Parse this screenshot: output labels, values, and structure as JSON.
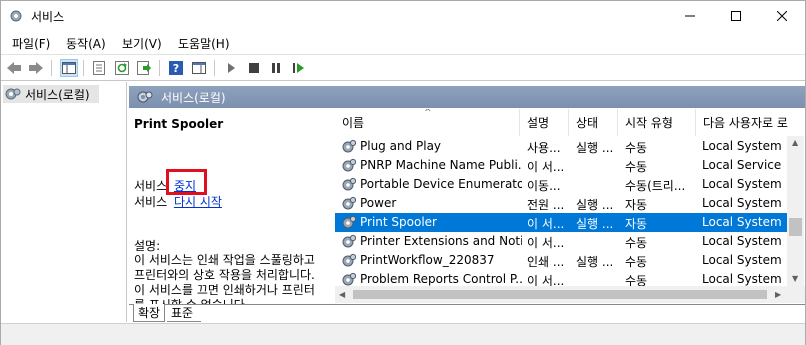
{
  "window": {
    "title": "서비스"
  },
  "menu": [
    "파일(F)",
    "동작(A)",
    "보기(V)",
    "도움말(H)"
  ],
  "tree": {
    "root_label": "서비스(로컬)"
  },
  "pane": {
    "header_label": "서비스(로컬)"
  },
  "detail": {
    "service_name": "Print Spooler",
    "line1_prefix": "서비스",
    "stop_link": "중지",
    "line2_prefix": "서비스",
    "restart_link": "다시 시작",
    "desc_label": "설명:",
    "desc_text": "이 서비스는 인쇄 작업을 스풀링하고\n프린터와의 상호 작용을 처리합니다.\n이 서비스를 끄면 인쇄하거나 프린터\n를 표시할 수 없습니다."
  },
  "columns": [
    "이름",
    "설명",
    "상태",
    "시작 유형",
    "다음 사용자로 로"
  ],
  "rows": [
    {
      "name": "Plug and Play",
      "desc": "사용...",
      "status": "실행 ...",
      "start": "수동",
      "logon": "Local System"
    },
    {
      "name": "PNRP Machine Name Publi...",
      "desc": "이 서...",
      "status": "",
      "start": "수동",
      "logon": "Local Service"
    },
    {
      "name": "Portable Device Enumerato...",
      "desc": "이동...",
      "status": "",
      "start": "수동(트리...",
      "logon": "Local System"
    },
    {
      "name": "Power",
      "desc": "전원 ...",
      "status": "실행 ...",
      "start": "자동",
      "logon": "Local System"
    },
    {
      "name": "Print Spooler",
      "desc": "이 서...",
      "status": "실행 ...",
      "start": "자동",
      "logon": "Local System"
    },
    {
      "name": "Printer Extensions and Noti...",
      "desc": "이 서...",
      "status": "",
      "start": "수동",
      "logon": "Local System"
    },
    {
      "name": "PrintWorkflow_220837",
      "desc": "인쇄 ...",
      "status": "실행 ...",
      "start": "수동",
      "logon": "Local System"
    },
    {
      "name": "Problem Reports Control P...",
      "desc": "이 서...",
      "status": "",
      "start": "수동",
      "logon": "Local System"
    }
  ],
  "selected_row_index": 4,
  "tabs": [
    "확장",
    "표준"
  ],
  "colors": {
    "selection": "#0078d7",
    "header": "#8ea1bd",
    "highlight_box": "#e01020",
    "link": "#0033cc"
  },
  "icons": {
    "title": "services-gear-icon",
    "toolbar": [
      "back-arrow-icon",
      "forward-arrow-icon",
      "show-tree-icon",
      "properties-icon",
      "refresh-icon",
      "export-list-icon",
      "help-icon",
      "show-hide-action-pane-icon",
      "start-icon",
      "stop-icon",
      "pause-icon",
      "restart-icon"
    ]
  }
}
